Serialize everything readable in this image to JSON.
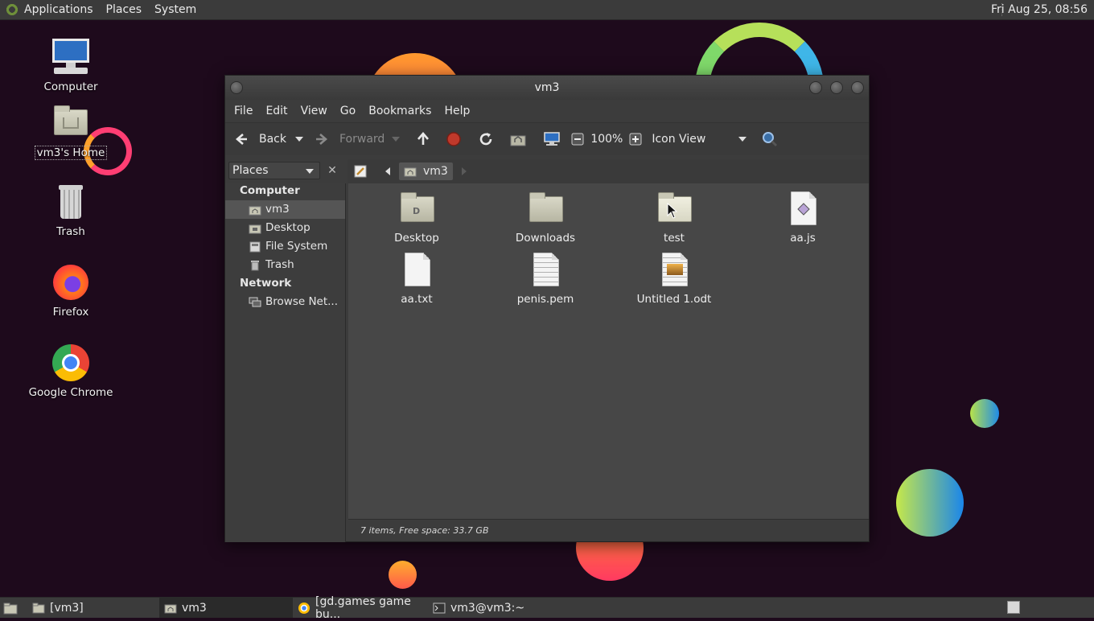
{
  "top_panel": {
    "menus": [
      "Applications",
      "Places",
      "System"
    ],
    "clock": "Fri Aug 25, 08:56"
  },
  "desktop": {
    "icons": [
      {
        "label": "Computer",
        "icon": "computer-icon"
      },
      {
        "label": "vm3's Home",
        "icon": "home-folder-icon"
      },
      {
        "label": "Trash",
        "icon": "trash-icon"
      },
      {
        "label": "Firefox",
        "icon": "firefox-icon"
      },
      {
        "label": "Google Chrome",
        "icon": "chrome-icon"
      }
    ]
  },
  "window": {
    "title": "vm3",
    "menus": [
      "File",
      "Edit",
      "View",
      "Go",
      "Bookmarks",
      "Help"
    ],
    "toolbar": {
      "back": "Back",
      "forward": "Forward",
      "zoom": "100%",
      "view_mode": "Icon View"
    },
    "sidebar": {
      "selector": "Places",
      "sections": [
        {
          "title": "Computer",
          "items": [
            {
              "label": "vm3",
              "icon": "home-folder-icon",
              "selected": true
            },
            {
              "label": "Desktop",
              "icon": "desktop-folder-icon"
            },
            {
              "label": "File System",
              "icon": "drive-icon"
            },
            {
              "label": "Trash",
              "icon": "trash-icon"
            }
          ]
        },
        {
          "title": "Network",
          "items": [
            {
              "label": "Browse Net...",
              "icon": "network-icon"
            }
          ]
        }
      ]
    },
    "path": [
      "vm3"
    ],
    "files": [
      {
        "name": "Desktop",
        "type": "folder",
        "icon": "desktop-folder-icon"
      },
      {
        "name": "Downloads",
        "type": "folder",
        "icon": "folder-icon"
      },
      {
        "name": "test",
        "type": "folder",
        "icon": "folder-icon"
      },
      {
        "name": "aa.js",
        "type": "file",
        "icon": "javascript-file-icon"
      },
      {
        "name": "aa.txt",
        "type": "file",
        "icon": "text-file-icon"
      },
      {
        "name": "penis.pem",
        "type": "file",
        "icon": "certificate-file-icon"
      },
      {
        "name": "Untitled 1.odt",
        "type": "file",
        "icon": "document-file-icon"
      }
    ],
    "status": "7 items, Free space: 33.7 GB"
  },
  "taskbar": {
    "tasks": [
      {
        "label": "[vm3]",
        "icon": "folder-icon"
      },
      {
        "label": "vm3",
        "icon": "home-folder-icon",
        "active": true
      },
      {
        "label": "[gd.games game bu...",
        "icon": "chrome-icon"
      },
      {
        "label": "vm3@vm3:~",
        "icon": "terminal-icon"
      }
    ]
  }
}
